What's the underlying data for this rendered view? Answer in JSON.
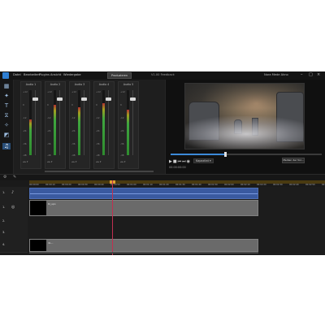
{
  "titlebar": {
    "menus": [
      "Datei",
      "Bearbeiten",
      "Plugins",
      "Ansicht",
      "Wiedergabe"
    ],
    "project_tab": "Produzieren",
    "title": "V1.00 Feedback",
    "user": "Nora Mede Akno"
  },
  "toolbar": {
    "tools": [
      {
        "icon": "media-library-icon",
        "glyph": "▦"
      },
      {
        "icon": "effects-icon",
        "glyph": "✦"
      },
      {
        "icon": "title-icon",
        "glyph": "T"
      },
      {
        "icon": "transition-icon",
        "glyph": "⧖"
      },
      {
        "icon": "particle-icon",
        "glyph": "✧"
      },
      {
        "icon": "pip-icon",
        "glyph": "◩"
      },
      {
        "icon": "audio-mixer-icon",
        "glyph": "♫"
      }
    ]
  },
  "mixer": {
    "channels": [
      {
        "label": "Audio 1",
        "level": 0.55,
        "fader": 0.12
      },
      {
        "label": "Audio 2",
        "level": 0.78,
        "fader": 0.12
      },
      {
        "label": "Audio 3",
        "level": 0.74,
        "fader": 0.12
      },
      {
        "label": "Audio 4",
        "level": 0.8,
        "fader": 0.12
      },
      {
        "label": "Audio 5",
        "level": 0.7,
        "fader": 0.12
      }
    ],
    "scale": [
      "+12",
      "0",
      "-12",
      "-24",
      "-36",
      "-48"
    ]
  },
  "preview": {
    "progress": 0.36,
    "quality_label": "Kapazitat ▾",
    "time_display": "00:00:00:00",
    "window_button": "Medien der Vor..."
  },
  "timeline": {
    "ruler_ticks": [
      "00:00:00",
      "00:00:10",
      "00:00:20",
      "00:00:30",
      "00:00:40",
      "00:00:50",
      "00:01:00",
      "00:01:10",
      "00:01:20",
      "00:01:30",
      "00:01:40",
      "00:01:50",
      "00:02:00",
      "00:02:10",
      "00:02:20",
      "00:02:30",
      "00:02:40",
      "00:02:50",
      "00:03:00"
    ],
    "tracks": [
      {
        "num": "1.",
        "clip_label": "",
        "type": "audio"
      },
      {
        "num": "1.",
        "clip_label": "Kl_spo",
        "type": "video"
      },
      {
        "num": "2.",
        "clip_label": "",
        "type": "empty"
      },
      {
        "num": "3.",
        "clip_label": "",
        "type": "empty"
      },
      {
        "num": "4.",
        "clip_label": "4L...",
        "type": "video"
      }
    ],
    "playhead_time": "00:00:30"
  },
  "colors": {
    "accent": "#2f7fd2",
    "playhead": "#c03050",
    "clip": "#6a6a6a",
    "ruler_zone": "#4a3a10"
  }
}
